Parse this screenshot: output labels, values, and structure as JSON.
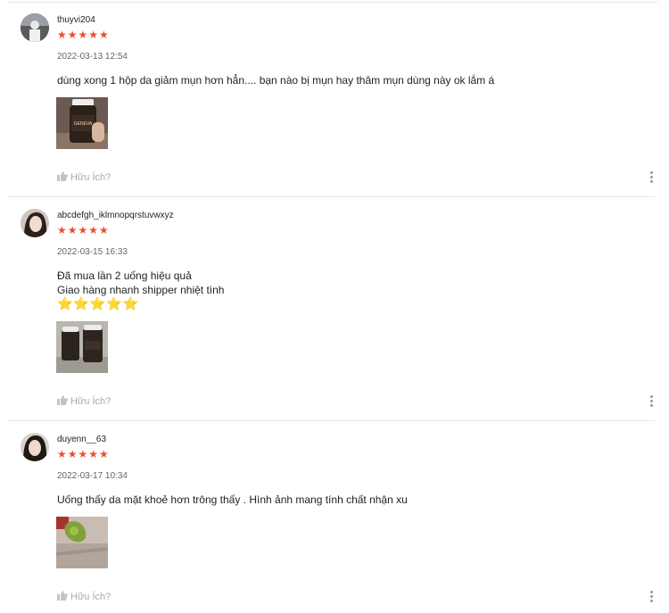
{
  "reviews": [
    {
      "username": "thuyvi204",
      "rating_stars": "★★★★★",
      "rating": 5,
      "date": "2022-03-13 12:54",
      "lines": [
        "dùng xong 1 hộp da giảm mụn hơn hẳn.... bạn nào bị mụn hay thâm mụn dùng này ok lắm á"
      ],
      "photo_label": "GENEVA",
      "helpful_label": "Hữu Ích?"
    },
    {
      "username": "abcdefgh_iklmnopqrstuvwxyz",
      "rating_stars": "★★★★★",
      "rating": 5,
      "date": "2022-03-15 16:33",
      "lines": [
        "Đã mua lần 2 uống hiệu quả",
        "Giao hàng nhanh shipper nhiệt tình"
      ],
      "emoji_stars": "⭐⭐⭐⭐⭐",
      "helpful_label": "Hữu Ích?"
    },
    {
      "username": "duyenn__63",
      "rating_stars": "★★★★★",
      "rating": 5,
      "date": "2022-03-17 10:34",
      "lines": [
        "Uống thấy da mặt khoẻ hơn trông thấy . Hình ảnh mang tính chất nhận xu"
      ],
      "helpful_label": "Hữu Ích?"
    }
  ],
  "colors": {
    "star": "#ee4d2d",
    "muted": "#aaaaaa"
  },
  "icons": {
    "helpful": "thumbs-up-icon",
    "more": "more-vertical-icon"
  }
}
